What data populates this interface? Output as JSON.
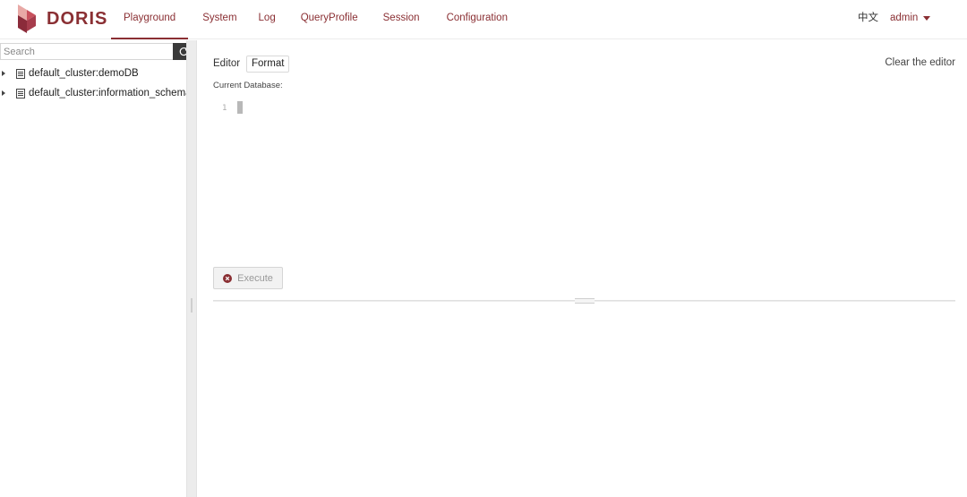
{
  "brand": {
    "name": "DORIS"
  },
  "nav": {
    "items": [
      {
        "label": "Playground",
        "active": true
      },
      {
        "label": "System"
      },
      {
        "label": "Log"
      },
      {
        "label": "QueryProfile"
      },
      {
        "label": "Session"
      },
      {
        "label": "Configuration"
      }
    ],
    "language": "中文",
    "user": "admin"
  },
  "sidebar": {
    "search_placeholder": "Search",
    "tree": [
      {
        "label": "default_cluster:demoDB",
        "icon": "database-icon"
      },
      {
        "label": "default_cluster:information_schema",
        "icon": "database-icon"
      }
    ]
  },
  "editor": {
    "title": "Editor",
    "format_label": "Format",
    "clear_label": "Clear the editor",
    "current_db_label": "Current Database:",
    "line_numbers": [
      "1"
    ],
    "execute_label": "Execute"
  },
  "colors": {
    "brand": "#8a2f33",
    "logo_light": "#e8a0a0",
    "logo_dark": "#8b2b3a"
  }
}
